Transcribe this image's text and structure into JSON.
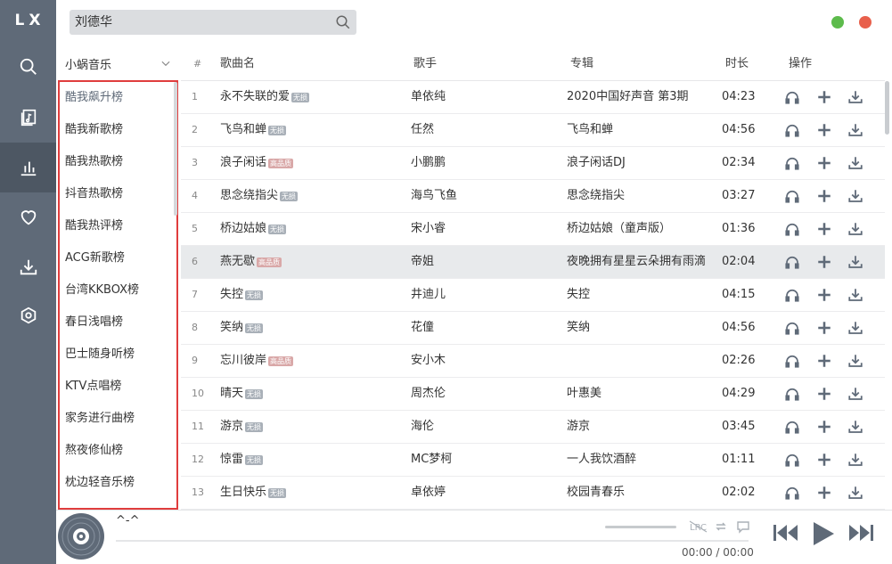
{
  "app": {
    "logo": "LX"
  },
  "search": {
    "value": "刘德华",
    "placeholder": ""
  },
  "source": {
    "selected": "小蜗音乐"
  },
  "boards": [
    "酷我飙升榜",
    "酷我新歌榜",
    "酷我热歌榜",
    "抖音热歌榜",
    "酷我热评榜",
    "ACG新歌榜",
    "台湾KKBOX榜",
    "春日浅唱榜",
    "巴士随身听榜",
    "KTV点唱榜",
    "家务进行曲榜",
    "熬夜修仙榜",
    "枕边轻音乐榜"
  ],
  "table": {
    "headers": {
      "num": "#",
      "title": "歌曲名",
      "singer": "歌手",
      "album": "专辑",
      "duration": "时长",
      "ops": "操作"
    },
    "badges": {
      "lossless": "无损",
      "hq": "高品质"
    },
    "rows": [
      {
        "num": "1",
        "title": "永不失联的爱",
        "badge": "无损",
        "singer": "单依纯",
        "album": "2020中国好声音 第3期",
        "duration": "04:23"
      },
      {
        "num": "2",
        "title": "飞鸟和蝉",
        "badge": "无损",
        "singer": "任然",
        "album": "飞鸟和蝉",
        "duration": "04:56"
      },
      {
        "num": "3",
        "title": "浪子闲话",
        "badge": "高品质",
        "singer": "小鹏鹏",
        "album": "浪子闲话DJ",
        "duration": "02:34"
      },
      {
        "num": "4",
        "title": "思念绕指尖",
        "badge": "无损",
        "singer": "海鸟飞鱼",
        "album": "思念绕指尖",
        "duration": "03:27"
      },
      {
        "num": "5",
        "title": "桥边姑娘",
        "badge": "无损",
        "singer": "宋小睿",
        "album": "桥边姑娘（童声版）",
        "duration": "01:36"
      },
      {
        "num": "6",
        "title": "燕无歇",
        "badge": "高品质",
        "singer": "帝姐",
        "album": "夜晚拥有星星云朵拥有雨滴",
        "duration": "02:04"
      },
      {
        "num": "7",
        "title": "失控",
        "badge": "无损",
        "singer": "井迪儿",
        "album": "失控",
        "duration": "04:15"
      },
      {
        "num": "8",
        "title": "笑纳",
        "badge": "无损",
        "singer": "花僮",
        "album": "笑纳",
        "duration": "04:56"
      },
      {
        "num": "9",
        "title": "忘川彼岸",
        "badge": "高品质",
        "singer": "安小木",
        "album": "",
        "duration": "02:26"
      },
      {
        "num": "10",
        "title": "晴天",
        "badge": "无损",
        "singer": "周杰伦",
        "album": "叶惠美",
        "duration": "04:29"
      },
      {
        "num": "11",
        "title": "游京",
        "badge": "无损",
        "singer": "海伦",
        "album": "游京",
        "duration": "03:45"
      },
      {
        "num": "12",
        "title": "惊雷",
        "badge": "无损",
        "singer": "MC梦柯",
        "album": "一人我饮酒醉",
        "duration": "01:11"
      },
      {
        "num": "13",
        "title": "生日快乐",
        "badge": "无损",
        "singer": "卓依婷",
        "album": "校园青春乐",
        "duration": "02:02"
      }
    ]
  },
  "player": {
    "title": "^-^",
    "time": "00:00 / 00:00",
    "lrc_label": "LRC"
  },
  "colors": {
    "sidebar": "#5f6a78",
    "accent": "#5f6a78",
    "highlight_box": "#e03d3d",
    "win_min": "#5dbb4c",
    "win_close": "#e8604c"
  },
  "icons": [
    "search-icon",
    "music-file-icon",
    "chart-icon",
    "heart-icon",
    "download-icon",
    "settings-icon",
    "headphones-icon",
    "add-icon",
    "download-icon",
    "disc-icon",
    "lyrics-icon",
    "repeat-icon",
    "comment-icon",
    "previous-icon",
    "play-icon",
    "next-icon",
    "chevron-down-icon"
  ]
}
